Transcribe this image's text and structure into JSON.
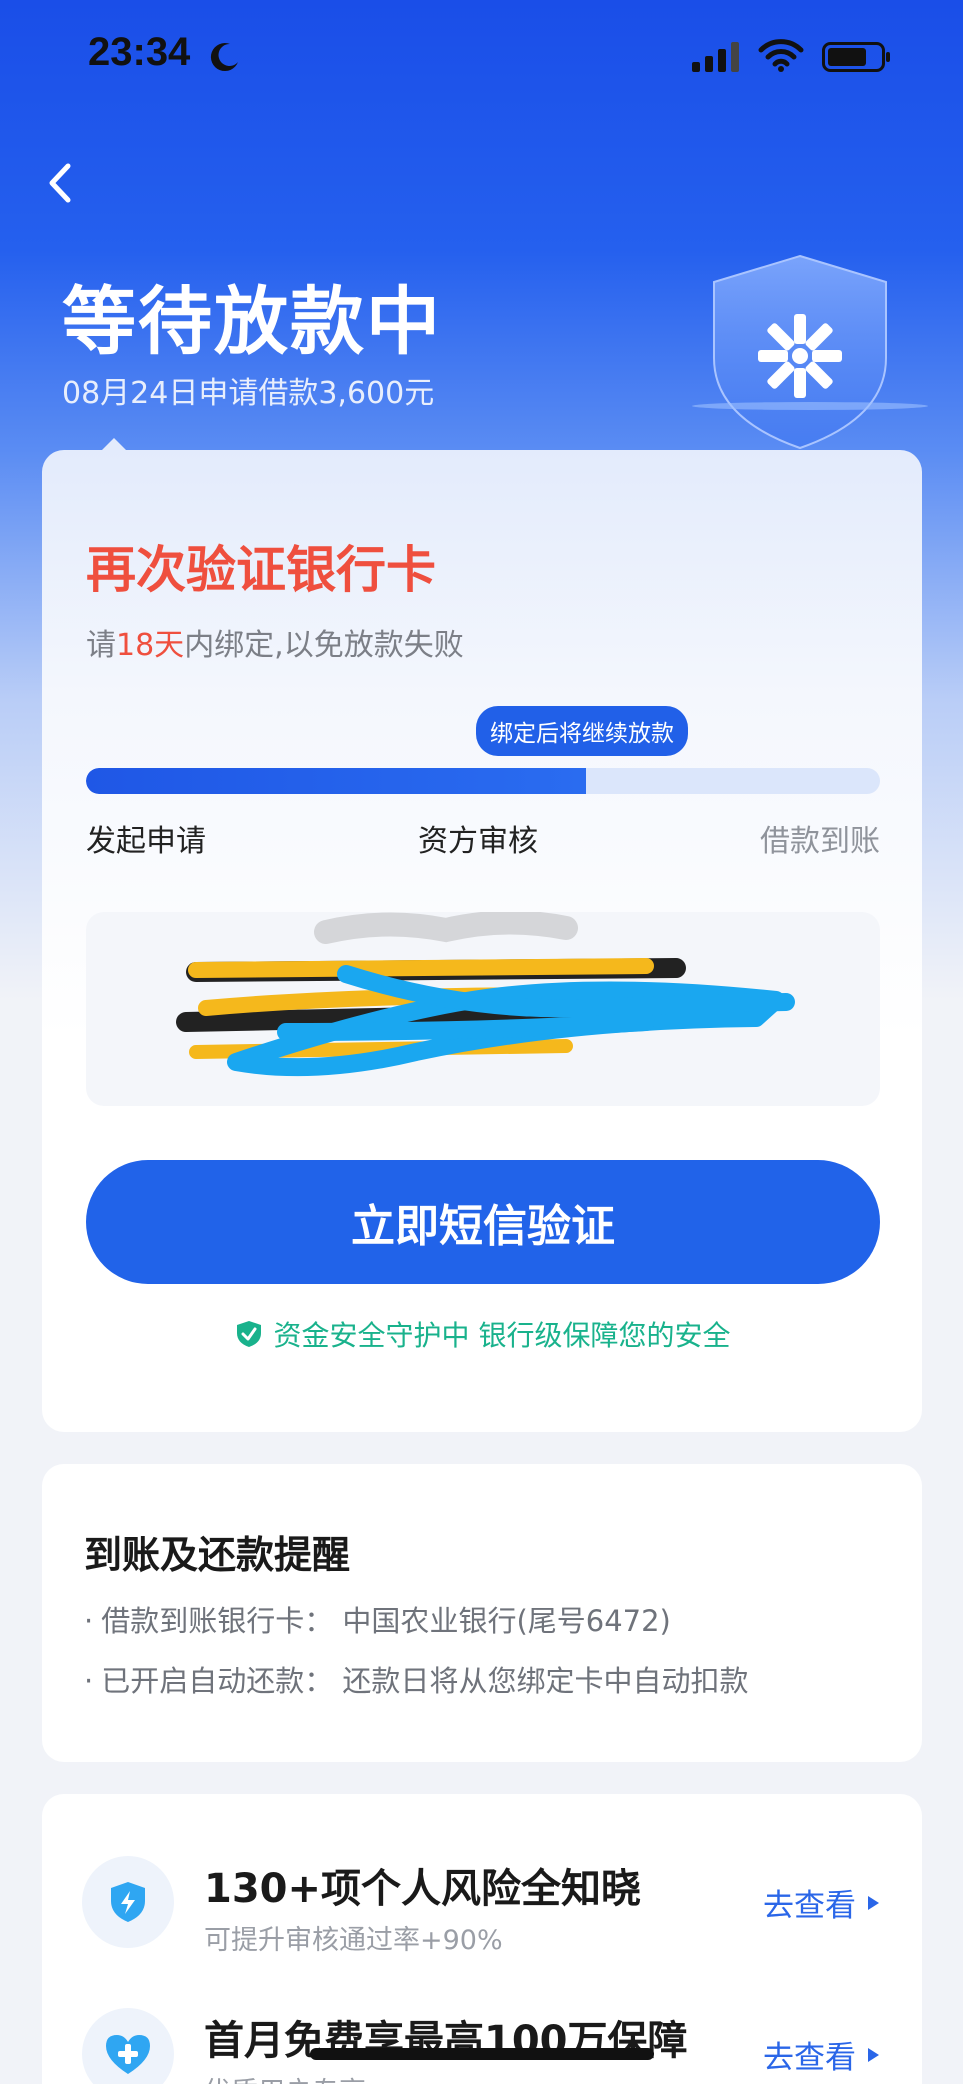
{
  "status_bar": {
    "time": "23:34",
    "icons": [
      "moon-icon",
      "signal-icon",
      "wifi-icon",
      "battery-icon"
    ]
  },
  "header": {
    "title": "等待放款中",
    "subtitle": "08月24日申请借款3,600元"
  },
  "verify_card": {
    "title": "再次验证银行卡",
    "sub_prefix": "请",
    "sub_days": "18天",
    "sub_suffix": "内绑定,以免放款失败",
    "tooltip": "绑定后将继续放款",
    "progress": 0.63,
    "steps": [
      "发起申请",
      "资方审核",
      "借款到账"
    ],
    "cta_label": "立即短信验证",
    "safety_text": "资金安全守护中 银行级保障您的安全"
  },
  "reminder_card": {
    "title": "到账及还款提醒",
    "lines": [
      "借款到账银行卡：  中国农业银行(尾号6472)",
      "已开启自动还款：  还款日将从您绑定卡中自动扣款"
    ]
  },
  "promo_card": {
    "items": [
      {
        "title": "130+项个人风险全知晓",
        "sub": "可提升审核通过率+90%",
        "link": "去查看",
        "icon": "lightning-shield-icon"
      },
      {
        "title": "首月免费享最高100万保障",
        "sub": "优质用户专享",
        "link": "去查看",
        "icon": "heart-plus-icon"
      }
    ]
  },
  "colors": {
    "primary": "#2163e9",
    "warning": "#ef4f3e",
    "safe": "#19b28c"
  }
}
